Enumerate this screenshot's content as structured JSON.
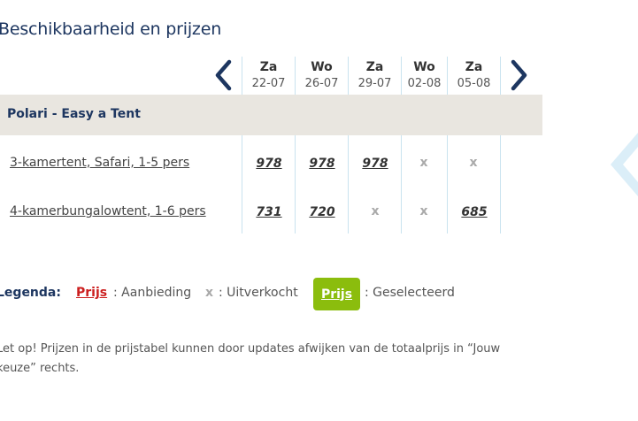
{
  "section": {
    "title": "Beschikbaarheid en prijzen"
  },
  "nav": {
    "prev_icon": "chevron-left-icon",
    "next_icon": "chevron-right-icon",
    "arrow_color": "#1d3660"
  },
  "dates": [
    {
      "dow": "Za",
      "date": "22-07"
    },
    {
      "dow": "Wo",
      "date": "26-07"
    },
    {
      "dow": "Za",
      "date": "29-07"
    },
    {
      "dow": "Wo",
      "date": "02-08"
    },
    {
      "dow": "Za",
      "date": "05-08"
    }
  ],
  "property": {
    "name": "Polari - Easy a Tent"
  },
  "accommodations": [
    {
      "name": "3-kamertent, Safari, 1-5 pers",
      "cells": [
        "978",
        "978",
        "978",
        "x",
        "x"
      ]
    },
    {
      "name": "4-kamerbungalowtent, 1-6 pers",
      "cells": [
        "731",
        "720",
        "x",
        "x",
        "685"
      ]
    }
  ],
  "legend": {
    "label": "Legenda:",
    "offer_sample": "Prijs",
    "offer_text": ": Aanbieding",
    "soldout_sample": "x",
    "soldout_text": ": Uitverkocht",
    "selected_sample": "Prijs",
    "selected_text": ": Geselecteerd",
    "offer_color": "#cc1f1f",
    "selected_color": "#8bbd0d"
  },
  "note": {
    "text": "Let op! Prijzen in de prijstabel kunnen door updates afwijken van de totaalprijs in “Jouw keuze” rechts."
  },
  "colors": {
    "title": "#1d3660",
    "band": "#e9e6e0",
    "divider": "#c9e3ef",
    "soldout": "#aaaaaa"
  }
}
